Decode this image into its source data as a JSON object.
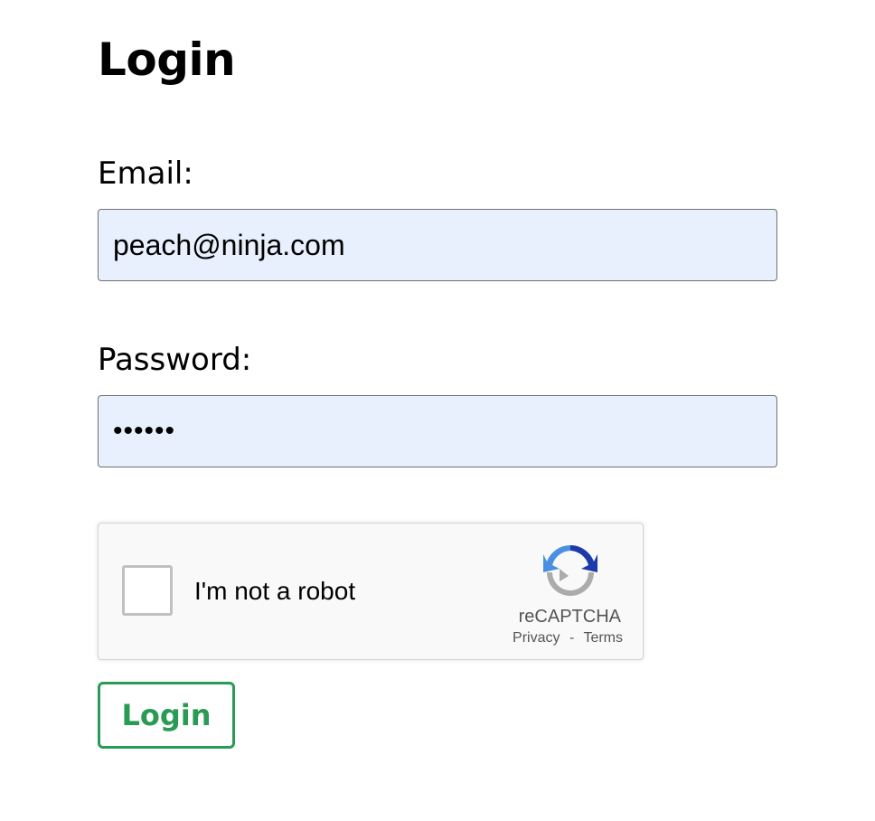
{
  "page": {
    "title": "Login"
  },
  "form": {
    "email_label": "Email:",
    "email_value": "peach@ninja.com",
    "password_label": "Password:",
    "password_value": "••••••",
    "submit_label": "Login"
  },
  "captcha": {
    "checkbox_label": "I'm not a robot",
    "checked": false,
    "brand": "reCAPTCHA",
    "privacy_link": "Privacy",
    "separator": "-",
    "terms_link": "Terms",
    "logo_icon": "recaptcha-logo-icon"
  },
  "colors": {
    "field_background": "#e8f0fe",
    "button_accent": "#2a9b55",
    "captcha_background": "#f9f9f9"
  }
}
